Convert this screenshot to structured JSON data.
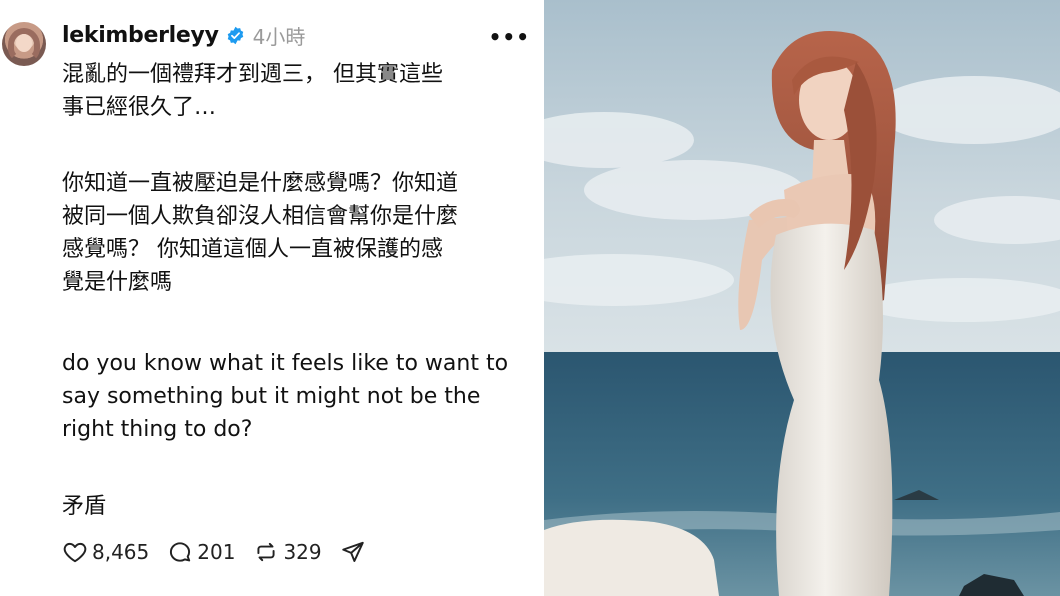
{
  "post": {
    "username": "lekimberleyy",
    "time": "4小時",
    "more_label": "•••",
    "paragraphs": [
      "混亂的一個禮拜才到週三， 但其實這些\n事已經很久了…",
      "你知道一直被壓迫是什麼感覺嗎？你知道\n被同一個人欺負卻沒人相信會幫你是什麼\n感覺嗎？ 你知道這個人一直被保護的感\n覺是什麼嗎",
      "do you know what it feels like to want to\nsay something but it might not be the\nright thing to do?",
      "矛盾"
    ],
    "likes": "8,465",
    "comments": "201",
    "reposts": "329"
  },
  "colors": {
    "verified": "#1d9bf0",
    "muted": "#9a9a9a",
    "text": "#111111"
  },
  "icons": [
    "heart-icon",
    "comment-icon",
    "repost-icon",
    "share-icon",
    "verified-badge-icon"
  ]
}
